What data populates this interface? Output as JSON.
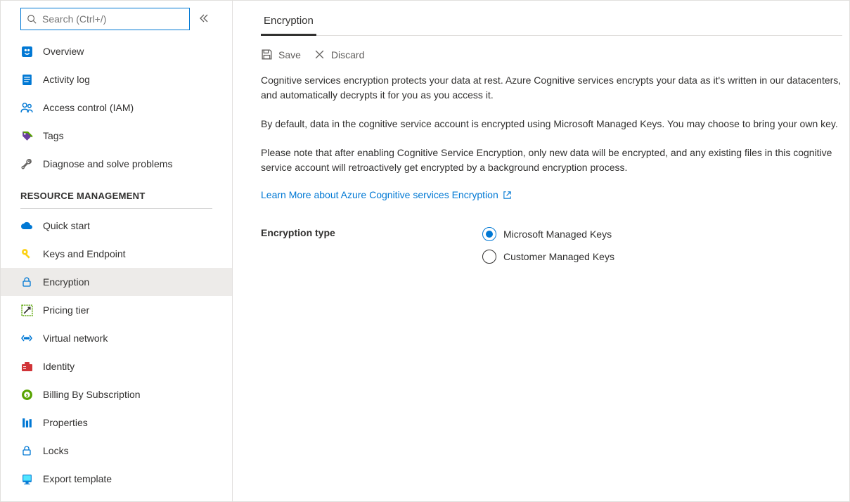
{
  "search": {
    "placeholder": "Search (Ctrl+/)"
  },
  "sidebar": {
    "top_items": [
      {
        "label": "Overview"
      },
      {
        "label": "Activity log"
      },
      {
        "label": "Access control (IAM)"
      },
      {
        "label": "Tags"
      },
      {
        "label": "Diagnose and solve problems"
      }
    ],
    "section_header": "RESOURCE MANAGEMENT",
    "resource_items": [
      {
        "label": "Quick start"
      },
      {
        "label": "Keys and Endpoint"
      },
      {
        "label": "Encryption"
      },
      {
        "label": "Pricing tier"
      },
      {
        "label": "Virtual network"
      },
      {
        "label": "Identity"
      },
      {
        "label": "Billing By Subscription"
      },
      {
        "label": "Properties"
      },
      {
        "label": "Locks"
      },
      {
        "label": "Export template"
      }
    ]
  },
  "tabs": {
    "active": "Encryption"
  },
  "toolbar": {
    "save_label": "Save",
    "discard_label": "Discard"
  },
  "body": {
    "p1": "Cognitive services encryption protects your data at rest. Azure Cognitive services encrypts your data as it's written in our datacenters, and automatically decrypts it for you as you access it.",
    "p2": "By default, data in the cognitive service account is encrypted using Microsoft Managed Keys. You may choose to bring your own key.",
    "p3": "Please note that after enabling Cognitive Service Encryption, only new data will be encrypted, and any existing files in this cognitive service account will retroactively get encrypted by a background encryption process.",
    "learn_more": "Learn More about Azure Cognitive services Encryption"
  },
  "form": {
    "encryption_type_label": "Encryption type",
    "options": [
      {
        "label": "Microsoft Managed Keys",
        "selected": true
      },
      {
        "label": "Customer Managed Keys",
        "selected": false
      }
    ]
  }
}
